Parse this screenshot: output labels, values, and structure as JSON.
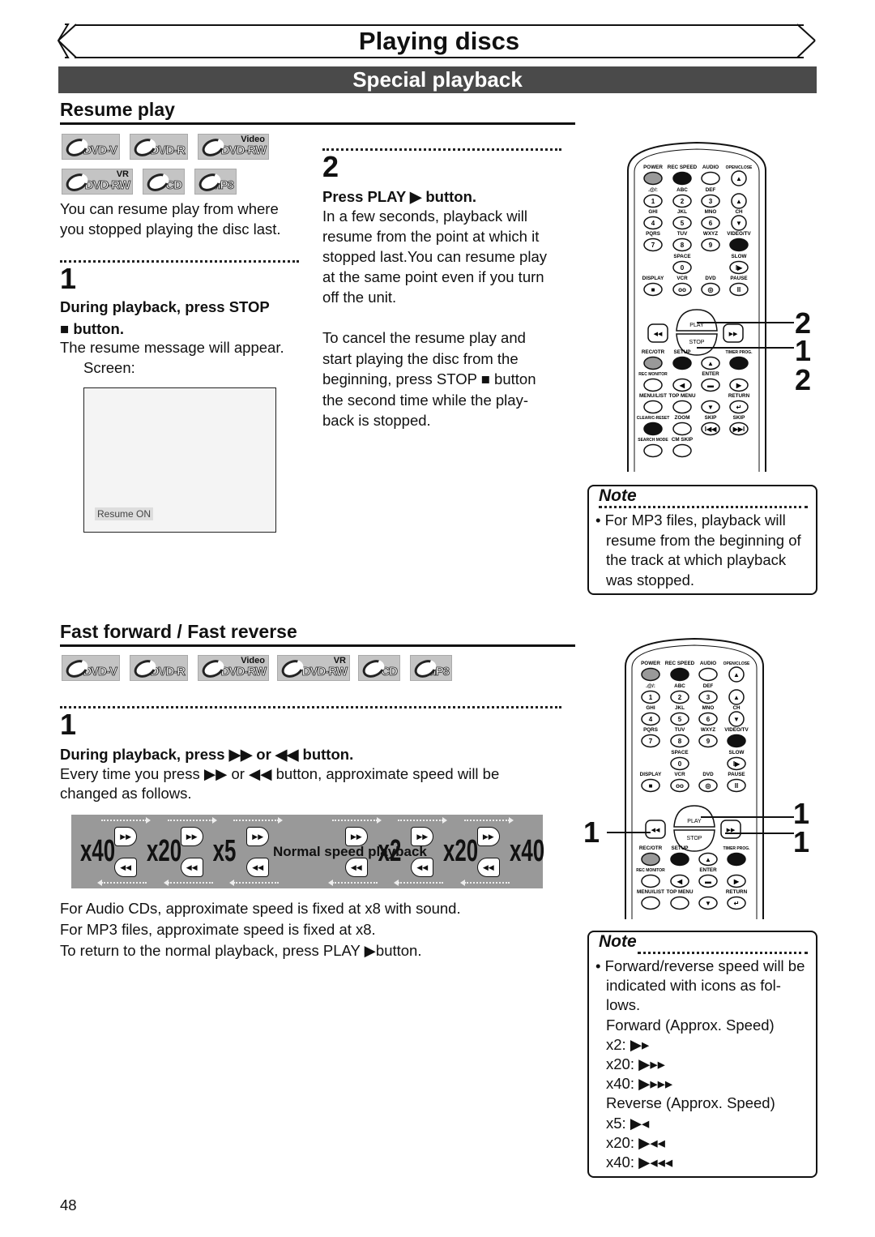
{
  "header": {
    "title": "Playing discs",
    "section": "Special playback"
  },
  "resume": {
    "title": "Resume play",
    "discs": [
      {
        "label": "DVD-V",
        "sup": ""
      },
      {
        "label": "DVD-R",
        "sup": ""
      },
      {
        "label": "DVD-RW",
        "sup": "Video"
      },
      {
        "label": "DVD-RW",
        "sup": "VR"
      },
      {
        "label": "CD",
        "sup": ""
      },
      {
        "label": "MP3",
        "sup": ""
      }
    ],
    "intro": [
      "You can resume play from where",
      "you stopped playing the disc last."
    ],
    "step1": {
      "num": "1",
      "heading": [
        "During playback, press STOP",
        "■ button."
      ],
      "body": [
        "The resume message will appear.",
        "Screen:"
      ]
    },
    "screen_label": "Resume ON",
    "step2": {
      "num": "2",
      "heading": "Press PLAY ▶ button.",
      "body": [
        "In a few seconds, playback will",
        "resume from the point at which it",
        "stopped last.You can resume play",
        "at the same point even if you turn",
        "off the unit."
      ],
      "body2": [
        "To cancel the resume play and",
        "start playing the disc from the",
        "beginning, press STOP ■ button",
        "the second time while the play-",
        "back is stopped."
      ]
    },
    "note": {
      "title": "Note",
      "lines": [
        "• For MP3 files, playback will",
        "resume from the beginning of",
        "the track at which playback",
        "was stopped."
      ]
    },
    "callouts": [
      "2",
      "1",
      "2"
    ]
  },
  "ff": {
    "title": "Fast forward / Fast reverse",
    "discs": [
      {
        "label": "DVD-V",
        "sup": ""
      },
      {
        "label": "DVD-R",
        "sup": ""
      },
      {
        "label": "DVD-RW",
        "sup": "Video"
      },
      {
        "label": "DVD-RW",
        "sup": "VR"
      },
      {
        "label": "CD",
        "sup": ""
      },
      {
        "label": "MP3",
        "sup": ""
      }
    ],
    "step1": {
      "num": "1",
      "heading": "During playback, press ▶▶ or ◀◀ button.",
      "body": [
        "Every time you press ▶▶ or ◀◀ button, approximate speed will be",
        "changed as follows."
      ]
    },
    "speeds": [
      "x40",
      "x20",
      "x5",
      "Normal speed playback",
      "x2",
      "x20",
      "x40"
    ],
    "after": [
      "For Audio CDs, approximate speed is fixed at x8 with sound.",
      "For MP3 files, approximate speed is fixed at x8.",
      "To return to the normal playback, press PLAY ▶button."
    ],
    "note": {
      "title": "Note",
      "lines": [
        "• Forward/reverse speed will be",
        "indicated with icons as fol-",
        "lows.",
        "Forward (Approx. Speed)",
        "x2:  ▶▸",
        "x20: ▶▸▸",
        "x40: ▶▸▸▸",
        "Reverse (Approx. Speed)",
        "x5:  ▶◂",
        "x20: ▶◂◂",
        "x40: ▶◂◂◂"
      ]
    },
    "callouts": [
      "1",
      "1",
      "1"
    ]
  },
  "remote": {
    "rows": [
      [
        {
          "l": "POWER",
          "f": "gray"
        },
        {
          "l": "REC SPEED",
          "f": "black"
        },
        {
          "l": "AUDIO",
          "f": "white"
        },
        {
          "l": "OPEN/CLOSE",
          "g": "▲",
          "round": true
        }
      ],
      [
        {
          "l": ".@/:",
          "g": "1"
        },
        {
          "l": "ABC",
          "g": "2"
        },
        {
          "l": "DEF",
          "g": "3"
        },
        {
          "l": "",
          "g": "▲",
          "round": true
        }
      ],
      [
        {
          "l": "GHI",
          "g": "4"
        },
        {
          "l": "JKL",
          "g": "5"
        },
        {
          "l": "MNO",
          "g": "6"
        },
        {
          "l": "CH",
          "g": "▼",
          "round": true
        }
      ],
      [
        {
          "l": "PQRS",
          "g": "7"
        },
        {
          "l": "TUV",
          "g": "8"
        },
        {
          "l": "WXYZ",
          "g": "9"
        },
        {
          "l": "VIDEO/TV",
          "f": "black"
        }
      ],
      [
        null,
        {
          "l": "SPACE",
          "g": "0"
        },
        null,
        {
          "l": "SLOW",
          "g": "I▶"
        }
      ],
      [
        {
          "l": "DISPLAY",
          "g": "■"
        },
        {
          "l": "VCR",
          "g": "oo"
        },
        {
          "l": "DVD",
          "g": "◎"
        },
        {
          "l": "PAUSE",
          "g": "II"
        }
      ],
      "transport",
      [
        {
          "l": "REC/OTR",
          "f": "gray"
        },
        {
          "l": "SETUP",
          "f": "black"
        },
        {
          "l": "",
          "g": "▲"
        },
        {
          "l": "TIMER PROG.",
          "f": "black"
        }
      ],
      [
        {
          "l": "REC MONITOR",
          "f": "white"
        },
        {
          "l": "",
          "g": "◀"
        },
        {
          "l": "ENTER",
          "g": "▬"
        },
        {
          "l": "",
          "g": "▶"
        }
      ],
      [
        {
          "l": "MENU/LIST",
          "f": "white"
        },
        {
          "l": "TOP MENU",
          "f": "white"
        },
        {
          "l": "",
          "g": "▼"
        },
        {
          "l": "RETURN",
          "g": "↵"
        }
      ],
      [
        {
          "l": "CLEAR/C-RESET",
          "f": "black"
        },
        {
          "l": "ZOOM",
          "f": "white"
        },
        {
          "l": "SKIP",
          "g": "I◀◀"
        },
        {
          "l": "SKIP",
          "g": "▶▶I"
        }
      ],
      [
        {
          "l": "SEARCH MODE",
          "f": "white"
        },
        {
          "l": "CM SKIP",
          "f": "white"
        },
        null,
        null
      ]
    ],
    "play": "PLAY",
    "stop": "STOP",
    "rew": "◀◀",
    "fwd": "▶▶"
  },
  "page_number": "48"
}
